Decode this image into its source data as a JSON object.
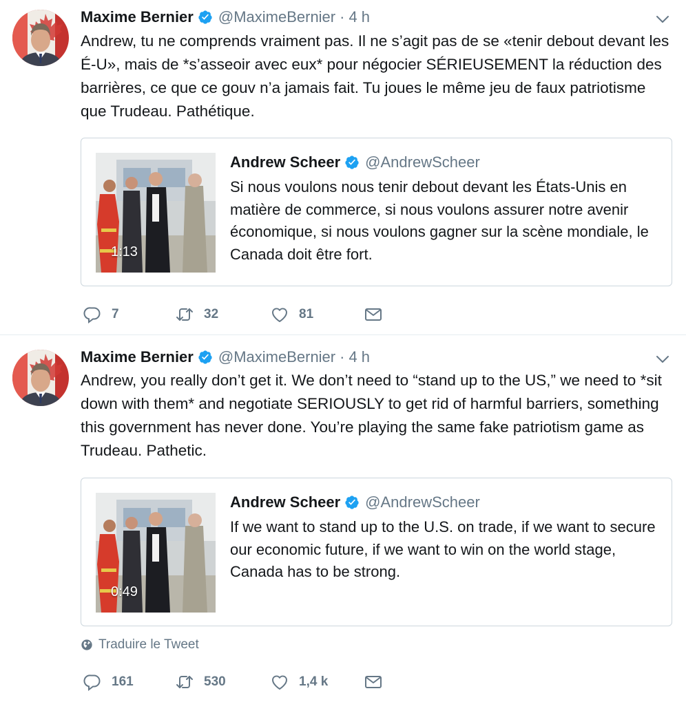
{
  "tweets": [
    {
      "author": {
        "name": "Maxime Bernier",
        "handle": "@MaximeBernier",
        "verified": true
      },
      "time": "4 h",
      "separator": "·",
      "text": "Andrew, tu ne comprends vraiment pas. Il ne s’agit pas de se «tenir debout devant les É-U», mais de *s’asseoir avec eux* pour négocier SÉRIEUSEMENT la réduction des barrières, ce que ce gouv n’a jamais fait. Tu joues le même jeu de faux patriotisme que Trudeau. Pathétique.",
      "quoted": {
        "author": {
          "name": "Andrew Scheer",
          "handle": "@AndrewScheer",
          "verified": true
        },
        "video_duration": "1:13",
        "text": "Si nous voulons nous tenir debout devant les États-Unis en matière de commerce, si nous voulons assurer notre avenir économique, si nous voulons gagner sur la scène mondiale, le Canada doit être fort."
      },
      "stats": {
        "replies": "7",
        "retweets": "32",
        "likes": "81"
      }
    },
    {
      "author": {
        "name": "Maxime Bernier",
        "handle": "@MaximeBernier",
        "verified": true
      },
      "time": "4 h",
      "separator": "·",
      "text": "Andrew, you really don’t get it. We don’t need to “stand up to the US,” we need to *sit down with them* and negotiate SERIOUSLY to get rid of harmful barriers, something this government has never done. You’re playing the same fake patriotism game as Trudeau. Pathetic.",
      "quoted": {
        "author": {
          "name": "Andrew Scheer",
          "handle": "@AndrewScheer",
          "verified": true
        },
        "video_duration": "0:49",
        "text": "If we want to stand up to the U.S. on trade, if we want to secure our economic future, if we want to win on the world stage, Canada has to be strong."
      },
      "translate_label": "Traduire le Tweet",
      "stats": {
        "replies": "161",
        "retweets": "530",
        "likes": "1,4 k"
      }
    }
  ],
  "icons": {
    "verified": "verified-badge-icon",
    "caret": "chevron-down-icon",
    "reply": "reply-icon",
    "retweet": "retweet-icon",
    "like": "heart-icon",
    "dm": "envelope-icon",
    "globe": "globe-icon"
  },
  "colors": {
    "text": "#14171a",
    "secondary": "#657786",
    "verified": "#1da1f2",
    "border": "#ccd6dd",
    "divider": "#e6ecf0"
  }
}
